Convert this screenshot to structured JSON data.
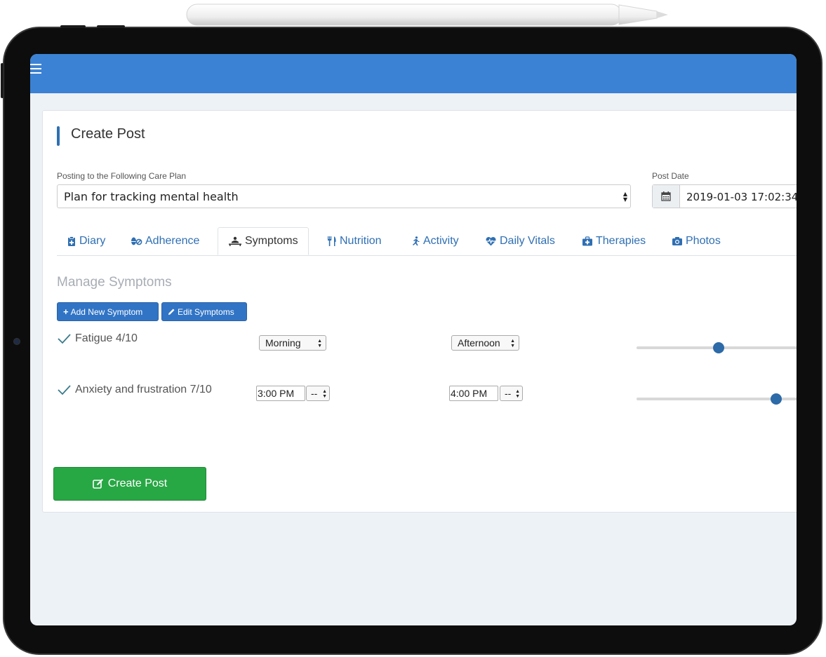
{
  "page": {
    "title": "Create Post",
    "care_plan_label": "Posting to the Following Care Plan",
    "care_plan_value": "Plan for tracking mental health",
    "post_date_label": "Post Date",
    "post_date_value": "2019-01-03 17:02:34"
  },
  "tabs": [
    {
      "label": "Diary",
      "icon": "clipboard-icon"
    },
    {
      "label": "Adherence",
      "icon": "pills-icon"
    },
    {
      "label": "Symptoms",
      "icon": "procedures-icon",
      "active": true
    },
    {
      "label": "Nutrition",
      "icon": "utensils-icon"
    },
    {
      "label": "Activity",
      "icon": "running-icon"
    },
    {
      "label": "Daily Vitals",
      "icon": "heartbeat-icon"
    },
    {
      "label": "Therapies",
      "icon": "medkit-icon"
    },
    {
      "label": "Photos",
      "icon": "camera-icon"
    }
  ],
  "symptoms": {
    "heading": "Manage Symptoms",
    "add_label": "Add New Symptom",
    "edit_label": "Edit Symptoms",
    "items": [
      {
        "name": "Fatigue 4/10",
        "start": "Morning",
        "end": "Afternoon",
        "severity": 4
      },
      {
        "name": "Anxiety and frustration 7/10",
        "start_time": "3:00 PM",
        "start_suffix": "--",
        "end_time": "4:00 PM",
        "end_suffix": "--",
        "severity": 7
      }
    ]
  },
  "actions": {
    "create_label": "Create Post"
  },
  "colors": {
    "topbar": "#3b82d4",
    "link": "#2f6fb3",
    "primary_button": "#3174c5",
    "success_button": "#28a745"
  }
}
